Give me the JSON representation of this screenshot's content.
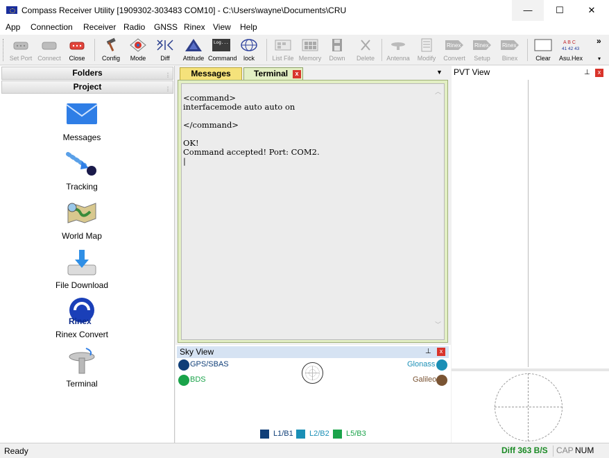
{
  "window": {
    "title": "Compass Receiver Utility [1909302-303483 COM10] - C:\\Users\\wayne\\Documents\\CRU",
    "minimize": "—",
    "maximize": "☐",
    "close": "✕"
  },
  "menu": [
    "App",
    "Connection",
    "Receiver",
    "Radio",
    "GNSS",
    "Rinex",
    "View",
    "Help"
  ],
  "toolbar": {
    "set_port": "Set Port",
    "connect": "Connect",
    "close": "Close",
    "config": "Config",
    "mode": "Mode",
    "diff": "Diff",
    "attitude": "Attitude",
    "command": "Command",
    "command_icon_text": "Log...",
    "lock": "lock",
    "list_file": "List File",
    "memory": "Memory",
    "down": "Down",
    "delete": "Delete",
    "antenna": "Antenna",
    "modify": "Modify",
    "convert": "Convert",
    "setup": "Setup",
    "binex": "Binex",
    "rinex_icon_text": "Rinex",
    "clear": "Clear",
    "asu_hex": "Asu.Hex",
    "asu_hex_icon_text": "A B C",
    "asu_hex_icon_text2": "41 42 43",
    "more": "»",
    "dropdown": "▾"
  },
  "left_panel": {
    "folders_header": "Folders",
    "project_header": "Project",
    "items": [
      {
        "label": "Messages",
        "icon": "envelope-icon"
      },
      {
        "label": "Tracking",
        "icon": "tracking-icon"
      },
      {
        "label": "World Map",
        "icon": "world-map-icon"
      },
      {
        "label": "File Download",
        "icon": "download-icon"
      },
      {
        "label": "Rinex Convert",
        "icon": "rinex-convert-icon",
        "icon_text": "Rinex"
      },
      {
        "label": "Terminal",
        "icon": "terminal-icon"
      }
    ]
  },
  "doc_tabs": {
    "messages": "Messages",
    "terminal": "Terminal",
    "close": "x",
    "dropdown": "▼"
  },
  "terminal": {
    "text": "<command>\ninterfacemode auto auto on\n\n</command>\n\nOK!\nCommand accepted! Port: COM2.\n|"
  },
  "sky_view": {
    "title": "Sky View",
    "pin": "📌",
    "close": "x",
    "constellations": [
      {
        "name": "GPS/SBAS",
        "color": "#0f3e78"
      },
      {
        "name": "BDS",
        "color": "#1aa34a"
      },
      {
        "name": "Glonass",
        "color": "#1a8fb6"
      },
      {
        "name": "Galileo",
        "color": "#7a5433"
      }
    ],
    "frequencies": [
      {
        "name": "L1/B1",
        "color": "#0f3e78"
      },
      {
        "name": "L2/B2",
        "color": "#1a8fb6"
      },
      {
        "name": "L5/B3",
        "color": "#1aa34a"
      }
    ]
  },
  "pvt_view": {
    "title": "PVT View",
    "pin": "📌",
    "close": "x"
  },
  "status": {
    "ready": "Ready",
    "diff": "Diff 363 B/S",
    "cap": "CAP",
    "num": "NUM"
  }
}
